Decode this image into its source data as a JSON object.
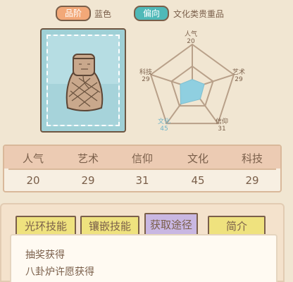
{
  "header": {
    "rank_label": "品阶",
    "rank_value": "蓝色",
    "bias_label": "偏向",
    "bias_value": "文化类贵重品"
  },
  "item": {
    "icon": "wooden-figurine-icon"
  },
  "radar": {
    "axes": [
      {
        "name": "人气",
        "value": "20"
      },
      {
        "name": "艺术",
        "value": "29"
      },
      {
        "name": "信仰",
        "value": "31"
      },
      {
        "name": "文化",
        "value": "45"
      },
      {
        "name": "科技",
        "value": "29"
      }
    ],
    "highlight": "文化",
    "colors": {
      "grid": "#b8a089",
      "fill": "#8fcfe0",
      "highlight": "#6fb4c8"
    }
  },
  "stats": {
    "headers": [
      "人气",
      "艺术",
      "信仰",
      "文化",
      "科技"
    ],
    "values": [
      "20",
      "29",
      "31",
      "45",
      "29"
    ]
  },
  "tabs": [
    {
      "label": "光环技能",
      "active": false
    },
    {
      "label": "镶嵌技能",
      "active": false
    },
    {
      "label": "获取途径",
      "active": true
    },
    {
      "label": "简介",
      "active": false
    }
  ],
  "content": {
    "lines": [
      "抽奖获得",
      "八卦炉许愿获得"
    ]
  }
}
